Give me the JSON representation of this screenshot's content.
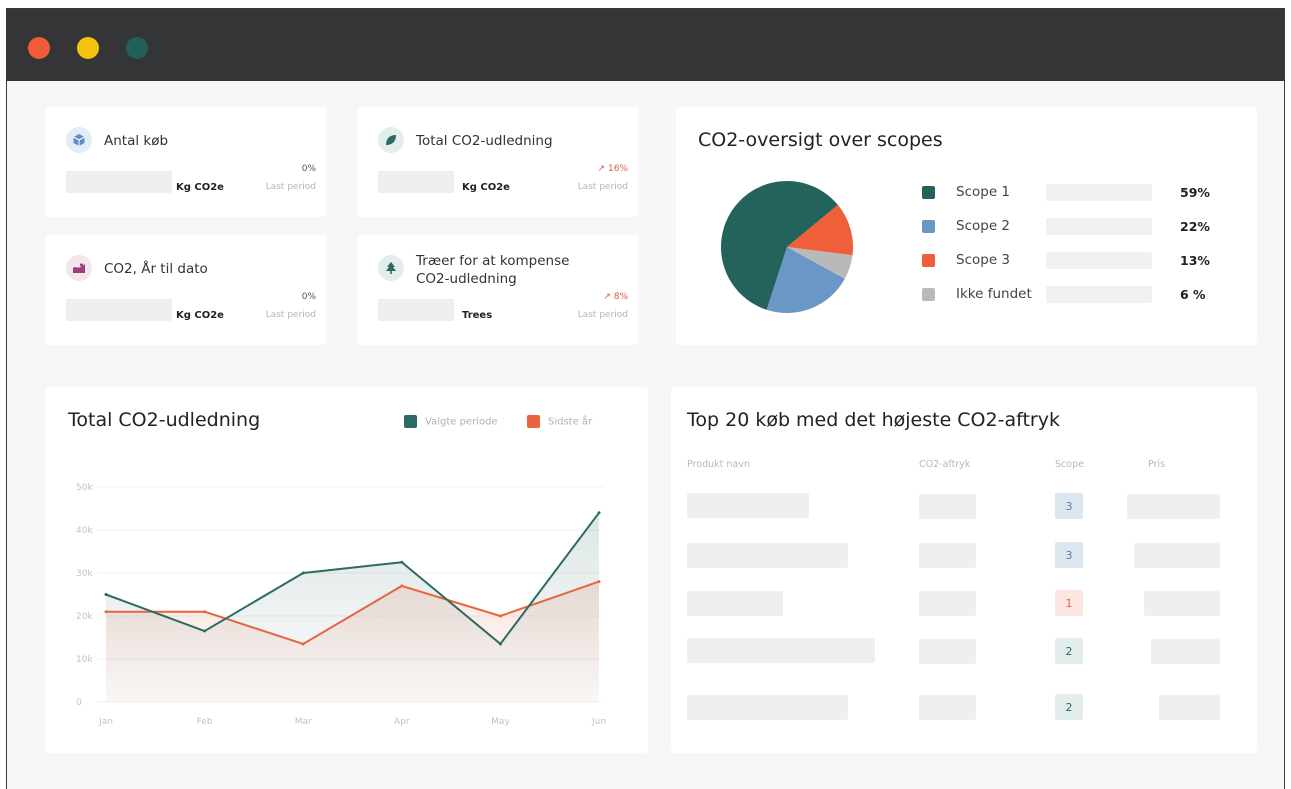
{
  "window": {
    "controls": [
      "close",
      "minimize",
      "maximize"
    ],
    "colors": {
      "close": "#f05c36",
      "minimize": "#f4c20d",
      "maximize": "#215f5a",
      "titlebar": "#333536"
    }
  },
  "kpis": [
    {
      "icon": "cube-icon",
      "title": "Antal køb",
      "unit": "Kg CO2e",
      "change": "0%",
      "trend": "flat",
      "last": "Last period"
    },
    {
      "icon": "leaf-icon",
      "title": "Total CO2-udledning",
      "unit": "Kg CO2e",
      "change": "16%",
      "trend": "up",
      "last": "Last period"
    },
    {
      "icon": "graph-icon",
      "title": "CO2, År til dato",
      "unit": "Kg CO2e",
      "change": "0%",
      "trend": "flat",
      "last": "Last period"
    },
    {
      "icon": "tree-icon",
      "title": "Træer for at kompense CO2-udledning",
      "unit": "Trees",
      "change": "8%",
      "trend": "up",
      "last": "Last period"
    }
  ],
  "pie": {
    "title": "CO2-oversigt over scopes",
    "chart_data": {
      "type": "pie",
      "slices": [
        {
          "label": "Scope 1",
          "value": 59,
          "display": "59%",
          "color": "#24625c"
        },
        {
          "label": "Scope 2",
          "value": 22,
          "display": "22%",
          "color": "#6b97c7"
        },
        {
          "label": "Scope 3",
          "value": 13,
          "display": "13%",
          "color": "#ee5f3a"
        },
        {
          "label": "Ikke fundet",
          "value": 6,
          "display": "6 %",
          "color": "#b9b9b9"
        }
      ]
    }
  },
  "line": {
    "title": "Total CO2-udledning",
    "chart_data": {
      "type": "area",
      "categories": [
        "Jan",
        "Feb",
        "Mar",
        "Apr",
        "May",
        "Jun"
      ],
      "ylim": [
        0,
        50000
      ],
      "yticks": [
        "0",
        "10k",
        "20k",
        "30k",
        "40k",
        "50k"
      ],
      "yticks_values": [
        0,
        10000,
        20000,
        30000,
        40000,
        50000
      ],
      "series": [
        {
          "name": "Valgte periode",
          "color": "#2c6a63",
          "values": [
            25000,
            16500,
            30000,
            32500,
            13500,
            44000
          ]
        },
        {
          "name": "Sidste år",
          "color": "#e8643f",
          "values": [
            21000,
            21000,
            13500,
            27000,
            20000,
            28000
          ]
        }
      ],
      "grid": true,
      "legend": "top-right"
    }
  },
  "table": {
    "title": "Top 20 køb med det højeste CO2-aftryk",
    "columns": [
      "Produkt navn",
      "CO2-aftryk",
      "Scope",
      "Pris"
    ],
    "rows": [
      {
        "scope": "3"
      },
      {
        "scope": "3"
      },
      {
        "scope": "1"
      },
      {
        "scope": "2"
      },
      {
        "scope": "2"
      }
    ]
  }
}
